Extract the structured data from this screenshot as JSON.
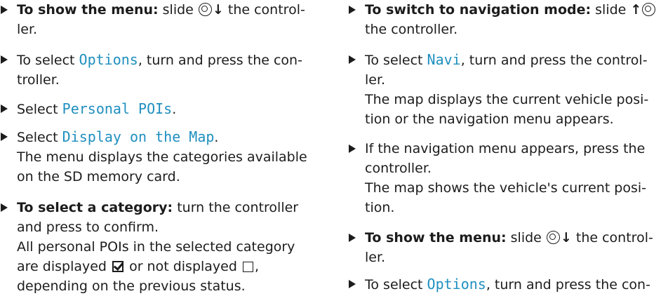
{
  "left": {
    "i1": {
      "bold": "To show the menu:",
      "a": "slide",
      "b": "the control-",
      "c": "ler."
    },
    "i2": {
      "a": "To select",
      "hl": "Options",
      "b": ", turn and press the con-",
      "c": "troller."
    },
    "i3": {
      "a": "Select",
      "hl": "Personal POIs",
      "b": "."
    },
    "i4": {
      "a": "Select",
      "hl": "Display on the Map",
      "b": ".",
      "r1": "The menu displays the categories available",
      "r2": "on the SD memory card."
    },
    "i5": {
      "bold": "To select a category:",
      "a": "turn the controller",
      "l2": "and press to confirm.",
      "l3": "All personal POIs in the selected category",
      "l4a": "are displayed",
      "l4b": "or not displayed",
      "l4c": ",",
      "l5": "depending on the previous status."
    }
  },
  "right": {
    "i1": {
      "bold": "To switch to navigation mode:",
      "a": "slide",
      "c": "the controller."
    },
    "i2": {
      "a": "To select",
      "hl": "Navi",
      "b": ", turn and press the control-",
      "c": "ler.",
      "r1": "The map displays the current vehicle posi-",
      "r2": "tion or the navigation menu appears."
    },
    "i3": {
      "a": "If the navigation menu appears, press the",
      "b": "controller.",
      "r1": "The map shows the vehicle's current posi-",
      "r2": "tion."
    },
    "i4": {
      "bold": "To show the menu:",
      "a": "slide",
      "b": "the control-",
      "c": "ler."
    },
    "i5": {
      "a": "To select",
      "hl": "Options",
      "b": ", turn and press the con-"
    }
  },
  "symbols": {
    "down": "↓",
    "up": "↑"
  }
}
